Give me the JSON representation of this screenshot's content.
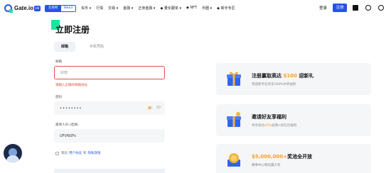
{
  "nav": {
    "logo_text": "Gate.io",
    "logo_badge": "HK",
    "seg_left": "交易所",
    "seg_right": "Web3",
    "menu": [
      "买币 ▾",
      "行情",
      "交易 ▾",
      "金融 ▾",
      "正身金融 ▾",
      "◆ 量化跟单 ▾",
      "◆ NFT",
      "币圈 ▾",
      "◆ 新手专区"
    ],
    "login": "登录",
    "signup": "注册"
  },
  "form": {
    "title": "立即注册",
    "tabs": [
      "邮箱",
      "手机号码"
    ],
    "email_label": "邮箱",
    "email_placeholder": "邮箱",
    "email_error": "请输入正确的邮箱地址",
    "password_label": "密码",
    "password_value": "••••••••",
    "invite_label": "邀请人ID (选填)",
    "invite_value": "UFVNUFs",
    "agree_prefix": "我同",
    "terms": "用户协议",
    "and": "和",
    "privacy": "隐私政策"
  },
  "promos": [
    {
      "title_pre": "注册赢取高达 ",
      "title_hl": "$100",
      "title_post": " 迎新礼",
      "sub_pre": "完成新手任务享100%中奖福利",
      "sub_hl": "",
      "sub_post": "",
      "icon": "gift-box-icon"
    },
    {
      "title_pre": "邀请好友享福利",
      "title_hl": "",
      "title_post": "",
      "sub_pre": "共享高达",
      "sub_hl": "40%",
      "sub_post": "返佣+拆红包福利",
      "icon": "gift-box-icon"
    },
    {
      "title_pre": "",
      "title_hl": "$5,000,000+",
      "title_post": "奖池全开放",
      "sub_pre": "赛事中心畅玩赢大奖",
      "sub_hl": "",
      "sub_post": "",
      "icon": "trophy-icon"
    }
  ],
  "colors": {
    "brand": "#2354e6",
    "accent": "#17e6a1",
    "error": "#e2523f",
    "highlight": "#f59f2e"
  }
}
